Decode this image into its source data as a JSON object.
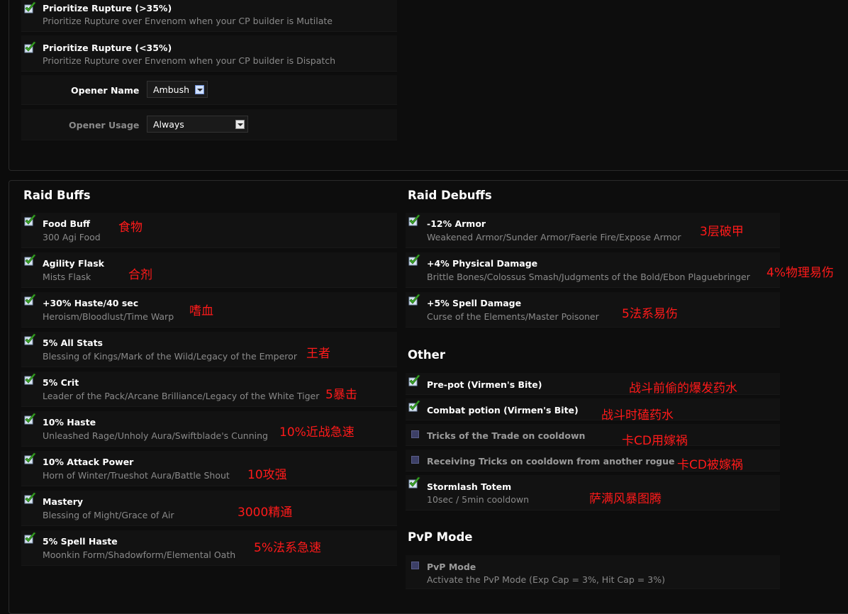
{
  "top": {
    "options": [
      {
        "title": "Prioritize Rupture (>35%)",
        "desc": "Prioritize Rupture over Envenom when your CP builder is Mutilate",
        "checked": true
      },
      {
        "title": "Prioritize Rupture (<35%)",
        "desc": "Prioritize Rupture over Envenom when your CP builder is Dispatch",
        "checked": true
      }
    ],
    "opener_name": {
      "label": "Opener Name",
      "value": "Ambush"
    },
    "opener_usage": {
      "label": "Opener Usage",
      "value": "Always"
    }
  },
  "raid_buffs": {
    "title": "Raid Buffs",
    "items": [
      {
        "title": "Food Buff",
        "desc": "300 Agi Food",
        "note": "食物",
        "checked": true
      },
      {
        "title": "Agility Flask",
        "desc": "Mists Flask",
        "note": "合剂",
        "checked": true
      },
      {
        "title": "+30% Haste/40 sec",
        "desc": "Heroism/Bloodlust/Time Warp",
        "note": "嗜血",
        "checked": true
      },
      {
        "title": "5% All Stats",
        "desc": "Blessing of Kings/Mark of the Wild/Legacy of the Emperor",
        "note": "王者",
        "checked": true
      },
      {
        "title": "5% Crit",
        "desc": "Leader of the Pack/Arcane Brilliance/Legacy of the White Tiger",
        "note": "5暴击",
        "checked": true
      },
      {
        "title": "10% Haste",
        "desc": "Unleashed Rage/Unholy Aura/Swiftblade's Cunning",
        "note": "10%近战急速",
        "checked": true
      },
      {
        "title": "10% Attack Power",
        "desc": "Horn of Winter/Trueshot Aura/Battle Shout",
        "note": "10攻强",
        "checked": true
      },
      {
        "title": "Mastery",
        "desc": "Blessing of Might/Grace of Air",
        "note": "3000精通",
        "checked": true
      },
      {
        "title": "5% Spell Haste",
        "desc": "Moonkin Form/Shadowform/Elemental Oath",
        "note": "5%法系急速",
        "checked": true
      }
    ]
  },
  "raid_debuffs": {
    "title": "Raid Debuffs",
    "items": [
      {
        "title": "-12% Armor",
        "desc": "Weakened Armor/Sunder Armor/Faerie Fire/Expose Armor",
        "note": "3层破甲",
        "checked": true
      },
      {
        "title": "+4% Physical Damage",
        "desc": "Brittle Bones/Colossus Smash/Judgments of the Bold/Ebon Plaguebringer",
        "note": "4%物理易伤",
        "checked": true
      },
      {
        "title": "+5% Spell Damage",
        "desc": "Curse of the Elements/Master Poisoner",
        "note": "5法系易伤",
        "checked": true
      }
    ]
  },
  "other": {
    "title": "Other",
    "items": [
      {
        "title": "Pre-pot (Virmen's Bite)",
        "desc": "",
        "note": "战斗前偷的爆发药水",
        "checked": true
      },
      {
        "title": "Combat potion (Virmen's Bite)",
        "desc": "",
        "note": "战斗时磕药水",
        "checked": true
      },
      {
        "title": "Tricks of the Trade on cooldown",
        "desc": "",
        "note": "卡CD用嫁祸",
        "checked": false
      },
      {
        "title": "Receiving Tricks on cooldown from another rogue",
        "desc": "",
        "note": "卡CD被嫁祸",
        "checked": false
      },
      {
        "title": "Stormlash Totem",
        "desc": "10sec / 5min cooldown",
        "note": "萨满风暴图腾",
        "checked": true
      }
    ]
  },
  "pvp": {
    "title": "PvP Mode",
    "items": [
      {
        "title": "PvP Mode",
        "desc": "Activate the PvP Mode (Exp Cap = 3%, Hit Cap = 3%)",
        "checked": false
      }
    ]
  },
  "colors": {
    "note": "#ff1a1a",
    "check": "#5fbf2a",
    "unchecked": "#3c3f66"
  }
}
